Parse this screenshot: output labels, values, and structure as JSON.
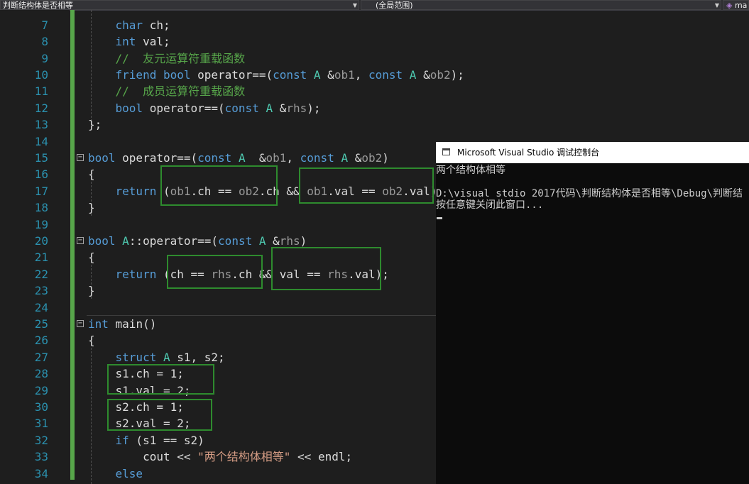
{
  "toolbar": {
    "file_scope": "判断结构体是否相等",
    "global_scope": "(全局范围)",
    "member": "ma"
  },
  "editor": {
    "line_numbers": [
      "7",
      "8",
      "9",
      "10",
      "11",
      "12",
      "13",
      "14",
      "15",
      "16",
      "17",
      "18",
      "19",
      "20",
      "21",
      "22",
      "23",
      "24",
      "25",
      "26",
      "27",
      "28",
      "29",
      "30",
      "31",
      "32",
      "33",
      "34"
    ]
  },
  "console": {
    "title": "Microsoft Visual Studio 调试控制台",
    "output": [
      "两个结构体相等",
      "",
      "D:\\visual stdio 2017代码\\判断结构体是否相等\\Debug\\判断结",
      "按任意键关闭此窗口..."
    ]
  }
}
